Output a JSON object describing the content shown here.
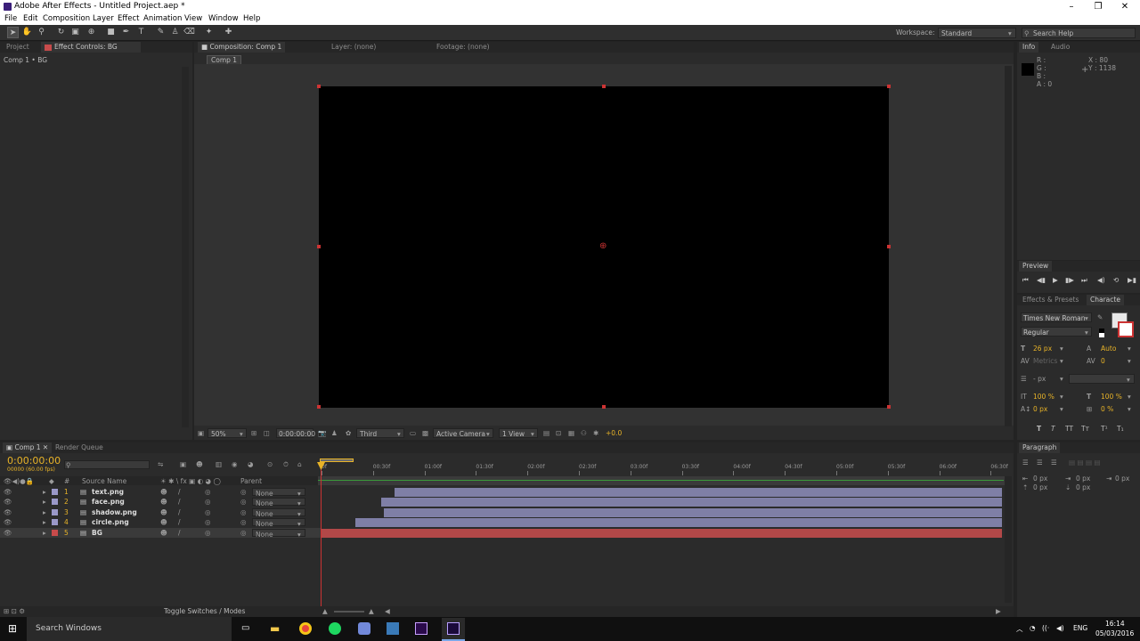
{
  "window": {
    "title": "Adobe After Effects - Untitled Project.aep *",
    "min": "–",
    "max": "❐",
    "close": "✕"
  },
  "menu": [
    "File",
    "Edit",
    "Composition",
    "Layer",
    "Effect",
    "Animation",
    "View",
    "Window",
    "Help"
  ],
  "toolbar": {
    "workspace_label": "Workspace:",
    "workspace_value": "Standard",
    "search_placeholder": "Search Help"
  },
  "left_panel": {
    "tab_project": "Project",
    "tab_effect_controls": "Effect Controls: BG",
    "breadcrumb": "Comp 1 • BG"
  },
  "center_panel": {
    "tab_composition": "Composition: Comp 1",
    "tab_layer": "Layer: (none)",
    "tab_footage": "Footage: (none)",
    "subtab": "Comp 1"
  },
  "viewer_bar": {
    "zoom": "50%",
    "timecode": "0:00:00:00",
    "resolution": "Third",
    "camera": "Active Camera",
    "view": "1 View",
    "exposure": "+0.0"
  },
  "info": {
    "tab_info": "Info",
    "tab_audio": "Audio",
    "r": "R :",
    "g": "G :",
    "b": "B :",
    "a": "A : 0",
    "x": "X : 80",
    "y": "Y : 1138"
  },
  "preview": {
    "tab": "Preview"
  },
  "character": {
    "tab_effects": "Effects & Presets",
    "tab_character": "Characte",
    "font": "Times New Roman",
    "style": "Regular",
    "size": "26 px",
    "leading": "Auto",
    "kerning": "Metrics",
    "tracking": "0",
    "stroke": "- px",
    "vscale": "100 %",
    "hscale": "100 %",
    "baseline": "0 px",
    "tsume": "0 %"
  },
  "paragraph": {
    "tab": "Paragraph",
    "indent_left": "0 px",
    "indent_first": "0 px",
    "indent_right": "0 px",
    "space_before": "0 px",
    "space_after": "0 px"
  },
  "timeline": {
    "tab_comp": "Comp 1",
    "tab_render": "Render Queue",
    "timecode": "0:00:00:00",
    "fps": "00000 (60.00 fps)",
    "col_num": "#",
    "col_source": "Source Name",
    "col_parent": "Parent",
    "ruler": [
      "0f",
      "00:30f",
      "01:00f",
      "01:30f",
      "02:00f",
      "02:30f",
      "03:00f",
      "03:30f",
      "04:00f",
      "04:30f",
      "05:00f",
      "05:30f",
      "06:00f",
      "06:30f"
    ],
    "toggle_label": "Toggle Switches / Modes",
    "layers": [
      {
        "num": "1",
        "name": "text.png",
        "parent": "None",
        "color": "#9a98c8",
        "start": 0.107
      },
      {
        "num": "2",
        "name": "face.png",
        "parent": "None",
        "color": "#9a98c8",
        "start": 0.087
      },
      {
        "num": "3",
        "name": "shadow.png",
        "parent": "None",
        "color": "#9a98c8",
        "start": 0.091
      },
      {
        "num": "4",
        "name": "circle.png",
        "parent": "None",
        "color": "#9a98c8",
        "start": 0.049
      },
      {
        "num": "5",
        "name": "BG",
        "parent": "None",
        "color": "#c84b4b",
        "start": 0.0
      }
    ]
  },
  "taskbar": {
    "search": "Search Windows",
    "lang": "ENG",
    "time": "16:14",
    "date": "05/03/2016"
  },
  "colors": {
    "accent_timecode": "#e8b328",
    "bg_bar": "#b24848",
    "layer_bar": "#7f7fa6"
  }
}
